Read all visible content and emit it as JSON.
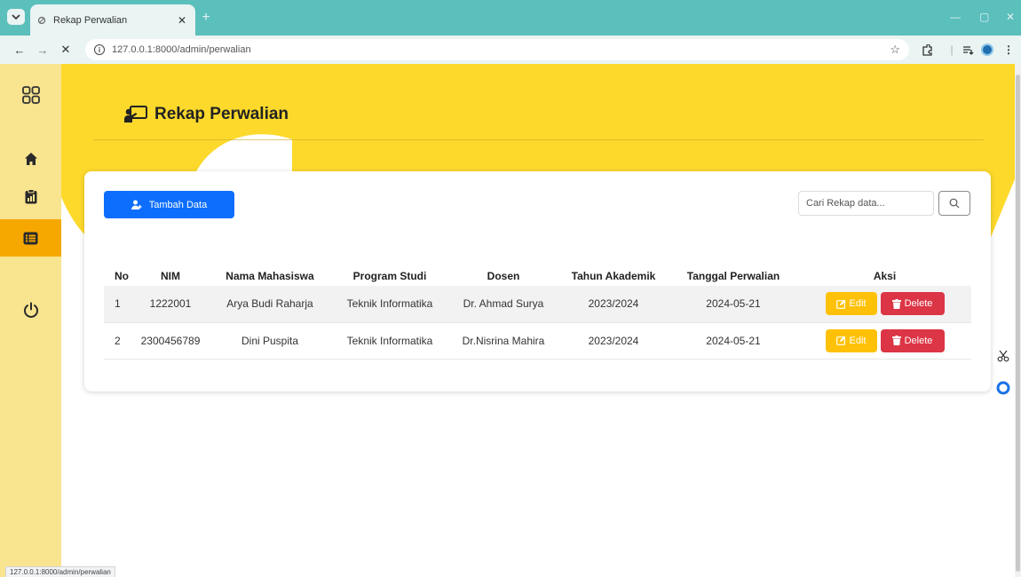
{
  "browser": {
    "tab_title": "Rekap Perwalian",
    "url": "127.0.0.1:8000/admin/perwalian",
    "status_url": "127.0.0.1:8000/admin/perwalian",
    "theme_color": "#5bbfbc"
  },
  "sidebar": {
    "items": [
      {
        "icon": "grid-icon"
      },
      {
        "icon": "home-icon"
      },
      {
        "icon": "clipboard-icon"
      },
      {
        "icon": "list-icon",
        "active": true
      },
      {
        "icon": "power-icon"
      }
    ],
    "bg_color": "#f9e48f",
    "active_color": "#f6a800"
  },
  "header": {
    "title": "Rekap Perwalian",
    "bg_color": "#fdd92c"
  },
  "toolbar": {
    "add_label": "Tambah Data",
    "search_placeholder": "Cari Rekap data..."
  },
  "table": {
    "columns": [
      "No",
      "NIM",
      "Nama Mahasiswa",
      "Program Studi",
      "Dosen",
      "Tahun Akademik",
      "Tanggal Perwalian",
      "Aksi"
    ],
    "rows": [
      {
        "no": "1",
        "nim": "1222001",
        "nama": "Arya Budi Raharja",
        "prodi": "Teknik Informatika",
        "dosen": "Dr. Ahmad Surya",
        "tahun": "2023/2024",
        "tanggal": "2024-05-21"
      },
      {
        "no": "2",
        "nim": "2300456789",
        "nama": "Dini Puspita",
        "prodi": "Teknik Informatika",
        "dosen": "Dr.Nisrina Mahira",
        "tahun": "2023/2024",
        "tanggal": "2024-05-21"
      }
    ],
    "edit_label": "Edit",
    "delete_label": "Delete"
  }
}
